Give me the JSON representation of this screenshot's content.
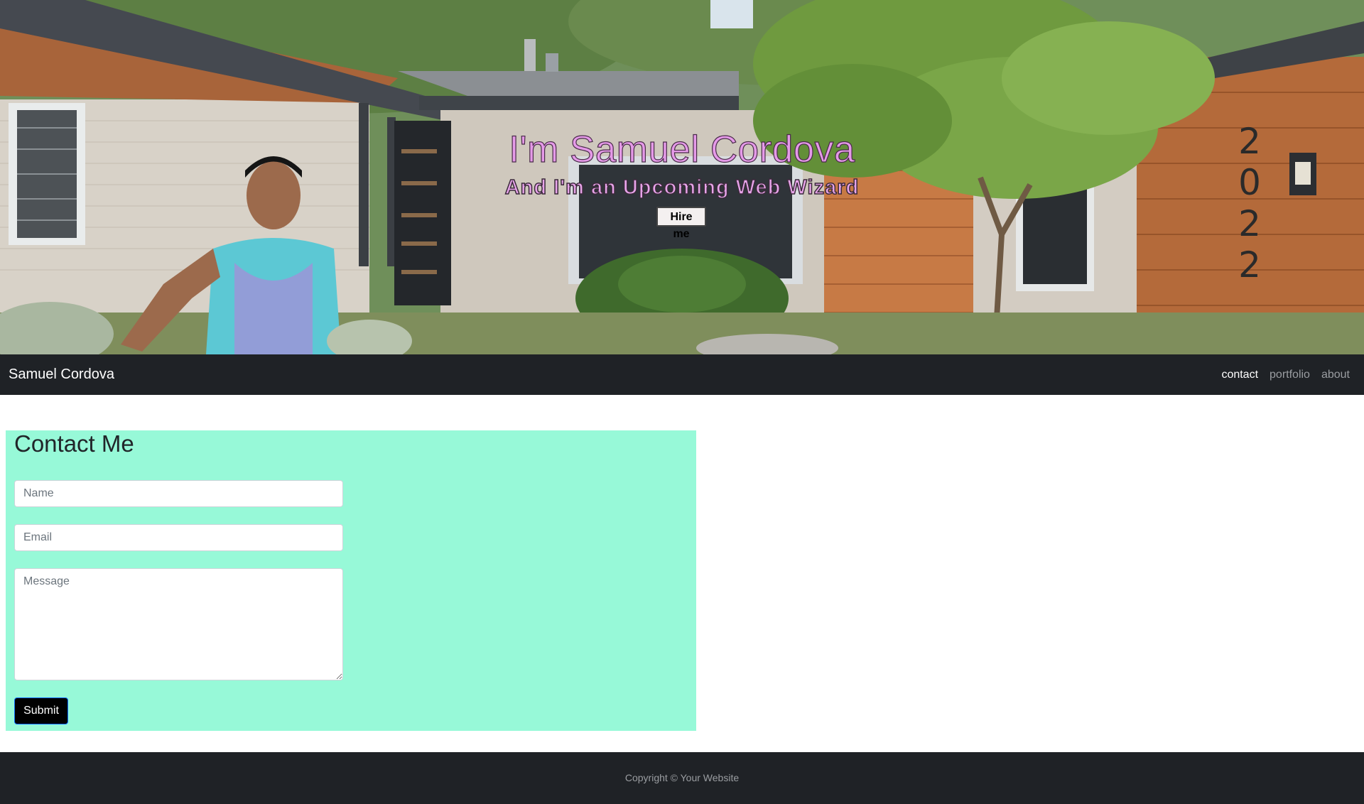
{
  "hero": {
    "title": "I'm Samuel Cordova",
    "subtitle": "And I'm an Upcoming Web Wizard",
    "cta_label": "Hire me",
    "house_number": "2022"
  },
  "navbar": {
    "brand": "Samuel Cordova",
    "links": [
      {
        "label": "contact",
        "active": true
      },
      {
        "label": "portfolio",
        "active": false
      },
      {
        "label": "about",
        "active": false
      }
    ]
  },
  "contact": {
    "title": "Contact Me",
    "name_placeholder": "Name",
    "email_placeholder": "Email",
    "message_placeholder": "Message",
    "submit_label": "Submit",
    "background_color": "#97f9d8"
  },
  "footer": {
    "copyright": "Copyright © Your Website"
  },
  "colors": {
    "nav_background": "#1f2226",
    "hero_text": "#e59ae8",
    "submit_background": "#000000"
  }
}
